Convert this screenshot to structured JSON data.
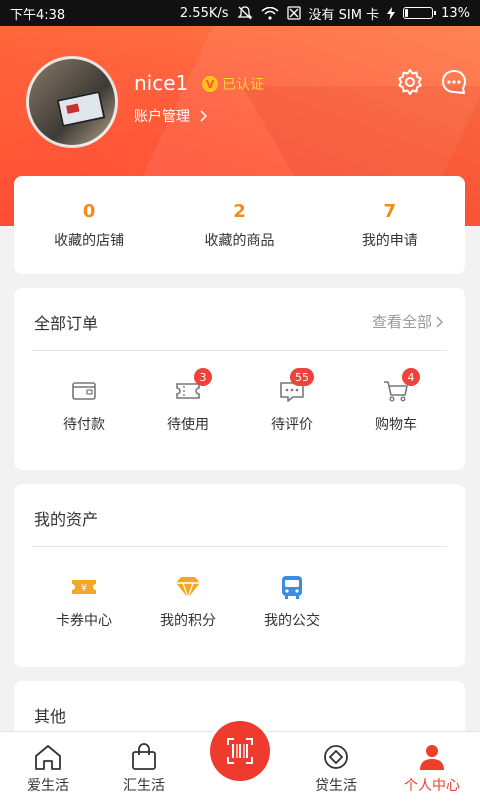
{
  "status_bar": {
    "time": "下午4:38",
    "speed": "2.55K/s",
    "signal": "没有 SIM 卡",
    "battery": "13%",
    "battery_level": 0.13
  },
  "profile": {
    "username": "nice1",
    "verified_label": "已认证",
    "verified_mark": "V",
    "account_label": "账户管理",
    "icons": [
      "settings-icon",
      "chat-icon"
    ]
  },
  "stats": [
    {
      "value": "0",
      "label": "收藏的店铺"
    },
    {
      "value": "2",
      "label": "收藏的商品"
    },
    {
      "value": "7",
      "label": "我的申请"
    }
  ],
  "orders": {
    "title": "全部订单",
    "view_all": "查看全部",
    "items": [
      {
        "label": "待付款",
        "badge": "",
        "icon": "wallet-icon"
      },
      {
        "label": "待使用",
        "badge": "3",
        "icon": "ticket-icon"
      },
      {
        "label": "待评价",
        "badge": "55",
        "icon": "comment-icon"
      },
      {
        "label": "购物车",
        "badge": "4",
        "icon": "cart-icon"
      }
    ]
  },
  "assets": {
    "title": "我的资产",
    "items": [
      {
        "label": "卡券中心",
        "icon": "coupon-icon"
      },
      {
        "label": "我的积分",
        "icon": "diamond-icon"
      },
      {
        "label": "我的公交",
        "icon": "bus-icon"
      }
    ]
  },
  "other": {
    "title": "其他"
  },
  "nav": {
    "items": [
      {
        "label": "爱生活",
        "icon": "home-icon"
      },
      {
        "label": "汇生活",
        "icon": "bag-icon"
      },
      {
        "label": "",
        "icon": "scan-icon"
      },
      {
        "label": "贷生活",
        "icon": "loan-icon"
      },
      {
        "label": "个人中心",
        "icon": "person-icon",
        "active": true
      }
    ]
  },
  "colors": {
    "brand": "#ef3f2b",
    "stat_number": "#f08c1a",
    "badge": "#f0413a",
    "verified": "#ffc21a"
  }
}
